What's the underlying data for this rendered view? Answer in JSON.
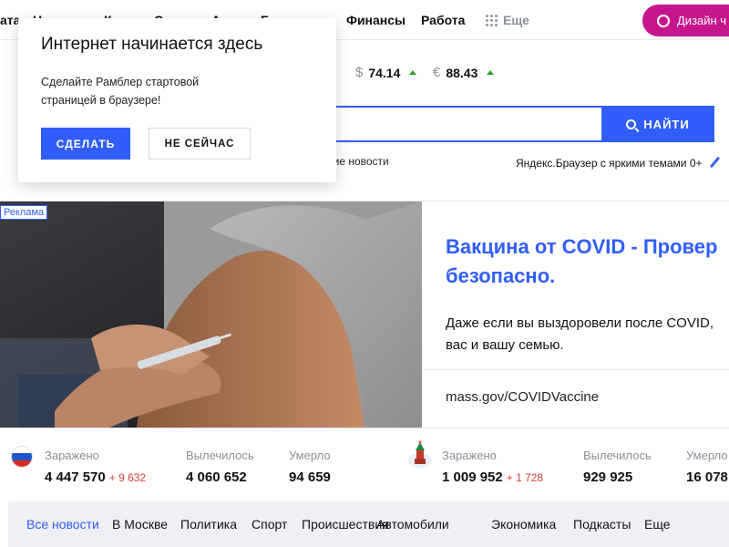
{
  "topnav": {
    "items": [
      "ата",
      "Н",
      "К",
      "С",
      "А",
      "Б",
      "Финансы",
      "Работа"
    ],
    "more_label": "Еще",
    "design_button": "Дизайн ч"
  },
  "popup": {
    "title": "Интернет начинается здесь",
    "text": "Сделайте Рамблер стартовой страницей в браузере!",
    "do_button": "СДЕЛАТЬ",
    "not_now_button": "НЕ СЕЙЧАС"
  },
  "currency": {
    "usd_symbol": "$",
    "usd_value": "74.14",
    "eur_symbol": "€",
    "eur_value": "88.43",
    "trend_color": "#2ca52c"
  },
  "search": {
    "value": "",
    "button_label": "НАЙТИ",
    "news_hint": "дние новости",
    "browser_promo": "Яндекс.Браузер с яркими темами 0+"
  },
  "ad": {
    "label": "Реклама",
    "title": "Вакцина от COVID - Провер\nбезопасно.",
    "description": "Даже если вы выздоровели после COVID,\nвас и вашу семью.",
    "url": "mass.gov/COVIDVaccine"
  },
  "covid": {
    "russia": {
      "infected_label": "Заражено",
      "infected_value": "4 447 570",
      "infected_delta": "+ 9 632",
      "recovered_label": "Вылечилось",
      "recovered_value": "4 060 652",
      "died_label": "Умерло",
      "died_value": "94 659"
    },
    "moscow": {
      "infected_label": "Заражено",
      "infected_value": "1 009 952",
      "infected_delta": "+ 1 728",
      "recovered_label": "Вылечилось",
      "recovered_value": "929 925",
      "died_label": "Умерло",
      "died_value": "16 078"
    }
  },
  "bottom_nav": {
    "tabs": [
      "Все новости",
      "В Москве",
      "Политика",
      "Спорт",
      "Происшествия",
      "Автомобили",
      "Экономика",
      "Подкасты",
      "Еще"
    ]
  },
  "colors": {
    "accent": "#315efb",
    "brand_pink": "#c6168d",
    "delta_red": "#e0403a"
  }
}
